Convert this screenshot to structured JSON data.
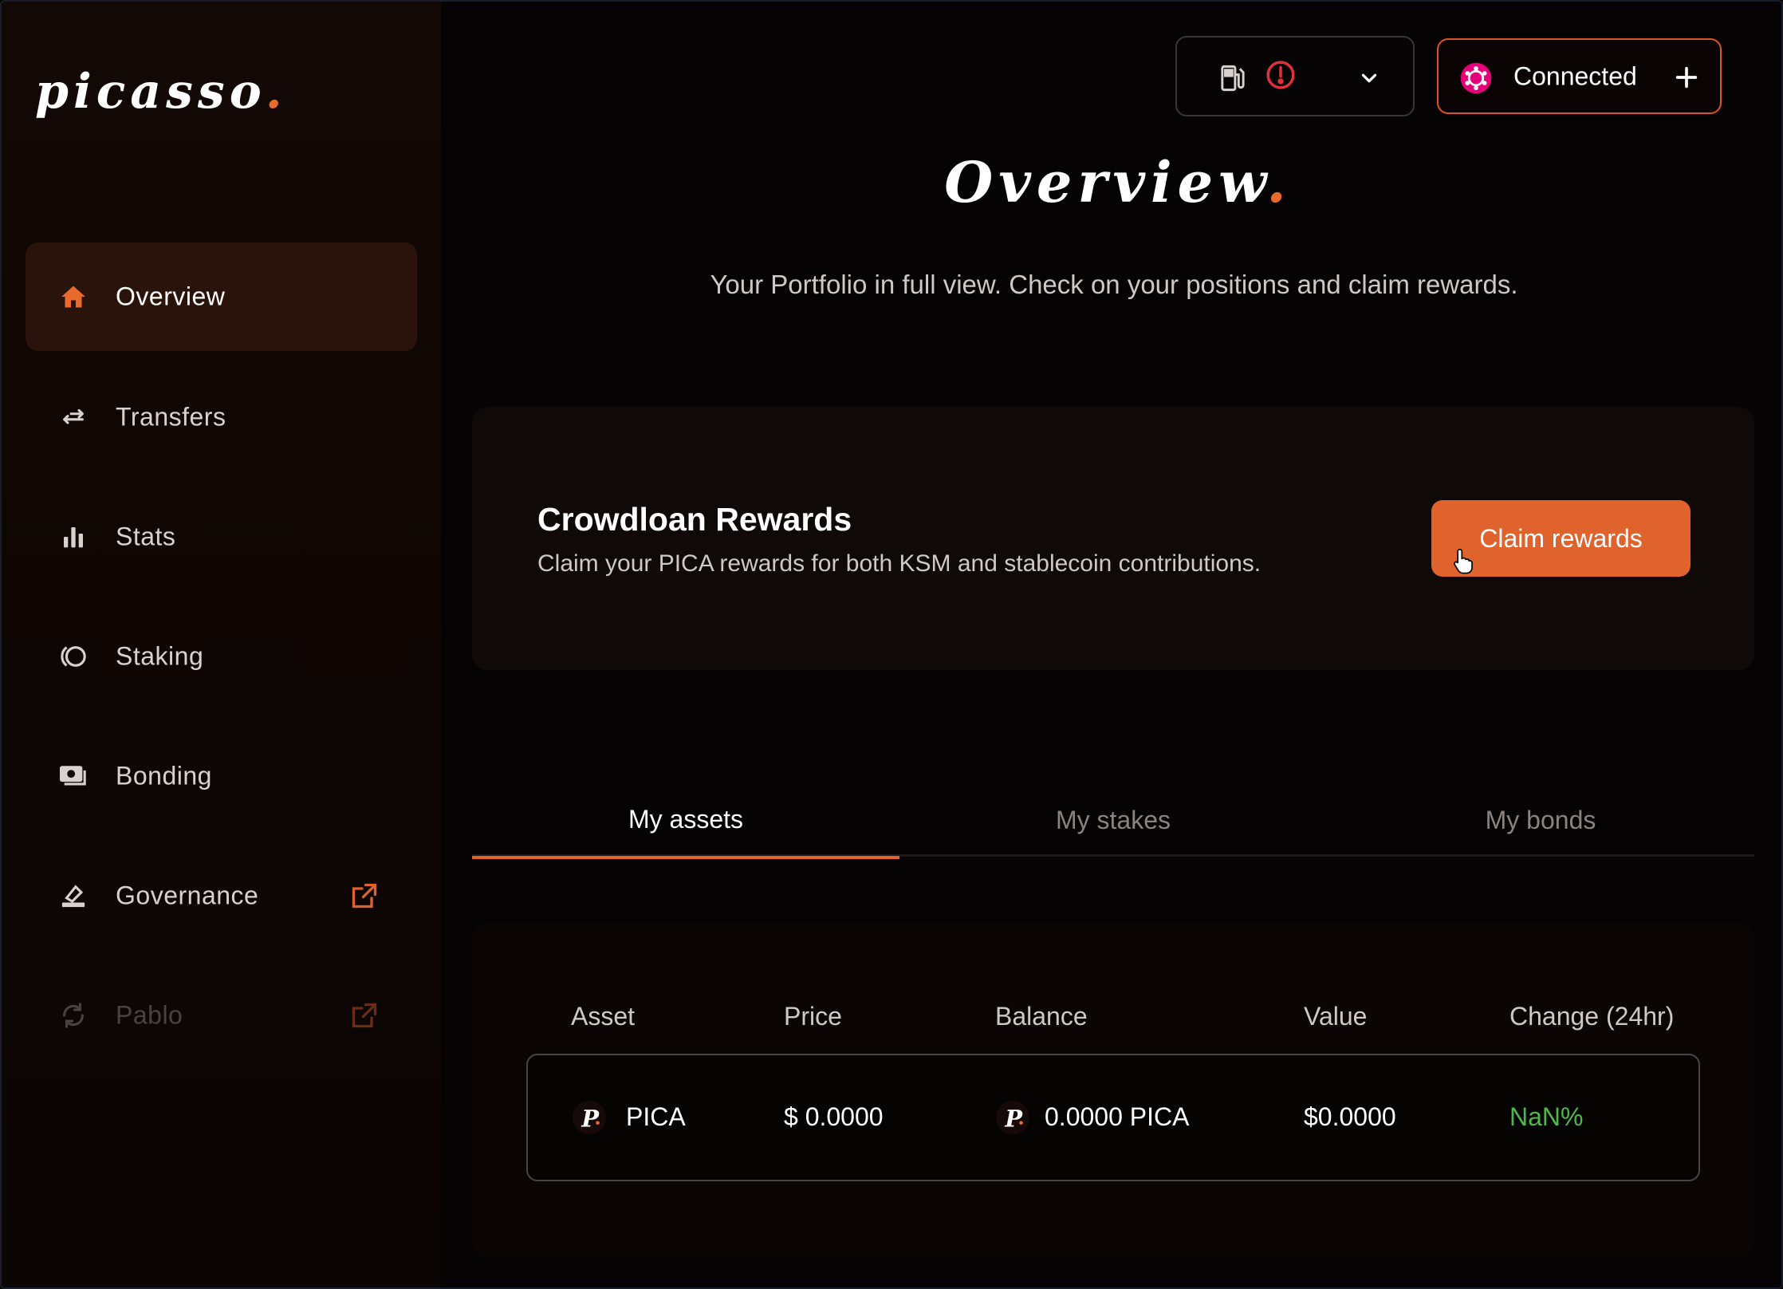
{
  "sidebar": {
    "logo_text": "picasso",
    "logo_dot": ".",
    "items": [
      {
        "label": "Overview",
        "icon": "home-icon",
        "active": true
      },
      {
        "label": "Transfers",
        "icon": "transfer-arrows-icon"
      },
      {
        "label": "Stats",
        "icon": "bar-chart-icon"
      },
      {
        "label": "Staking",
        "icon": "staking-icon"
      },
      {
        "label": "Bonding",
        "icon": "bonding-icon"
      },
      {
        "label": "Governance",
        "icon": "governance-icon",
        "external": true
      },
      {
        "label": "Pablo",
        "icon": "refresh-icon",
        "external": true,
        "disabled": true
      }
    ]
  },
  "header": {
    "gas_icon": "gas-pump-icon",
    "warning_icon": "alert-circle-icon",
    "wallet_label": "Connected",
    "wallet_icon": "polkadot-icon"
  },
  "page": {
    "title": "Overview",
    "title_dot": ".",
    "subtitle": "Your Portfolio in full view. Check on your positions and claim rewards."
  },
  "crowdloan": {
    "title": "Crowdloan Rewards",
    "description": "Claim your PICA rewards for both KSM and stablecoin contributions.",
    "button_label": "Claim rewards"
  },
  "tabs": [
    {
      "label": "My assets",
      "active": true
    },
    {
      "label": "My stakes"
    },
    {
      "label": "My bonds"
    }
  ],
  "table": {
    "columns": [
      "Asset",
      "Price",
      "Balance",
      "Value",
      "Change (24hr)"
    ],
    "rows": [
      {
        "asset": "PICA",
        "price": "$ 0.0000",
        "balance": "0.0000 PICA",
        "value": "$0.0000",
        "change": "NaN%"
      }
    ]
  },
  "colors": {
    "accent": "#e0622c",
    "positive": "#4fb84a",
    "background": "#050303"
  }
}
